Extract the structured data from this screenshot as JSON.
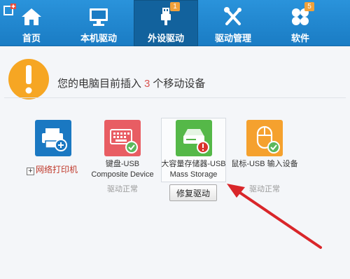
{
  "nav": {
    "items": [
      {
        "label": "首页",
        "icon": "home-icon"
      },
      {
        "label": "本机驱动",
        "icon": "monitor-icon"
      },
      {
        "label": "外设驱动",
        "icon": "usb-icon",
        "badge": "1",
        "active": true
      },
      {
        "label": "驱动管理",
        "icon": "tools-icon"
      },
      {
        "label": "软件",
        "icon": "apps-icon",
        "badge": "5"
      }
    ]
  },
  "notice": {
    "prefix": "您的电脑目前插入",
    "count": "3",
    "suffix": "个移动设备"
  },
  "devices": [
    {
      "name": "网络打印机",
      "icon": "printer-icon",
      "tile_color": "#1a78c2"
    },
    {
      "name_line1": "键盘-USB",
      "name_line2": "Composite Device",
      "status": "驱动正常",
      "icon": "keyboard-icon",
      "tile_color": "#e85d63"
    },
    {
      "name_line1": "大容量存储器-USB",
      "name_line2": "Mass Storage",
      "icon": "storage-icon",
      "tile_color": "#55b848",
      "action": "修复驱动"
    },
    {
      "name_line1": "鼠标-USB 输入设备",
      "status": "驱动正常",
      "icon": "mouse-icon",
      "tile_color": "#f5a12e"
    }
  ],
  "colors": {
    "nav_bg": "#1f86cf",
    "nav_active": "#12629d",
    "badge": "#f0a13a",
    "warning": "#f6a623",
    "arrow": "#d9262a"
  }
}
